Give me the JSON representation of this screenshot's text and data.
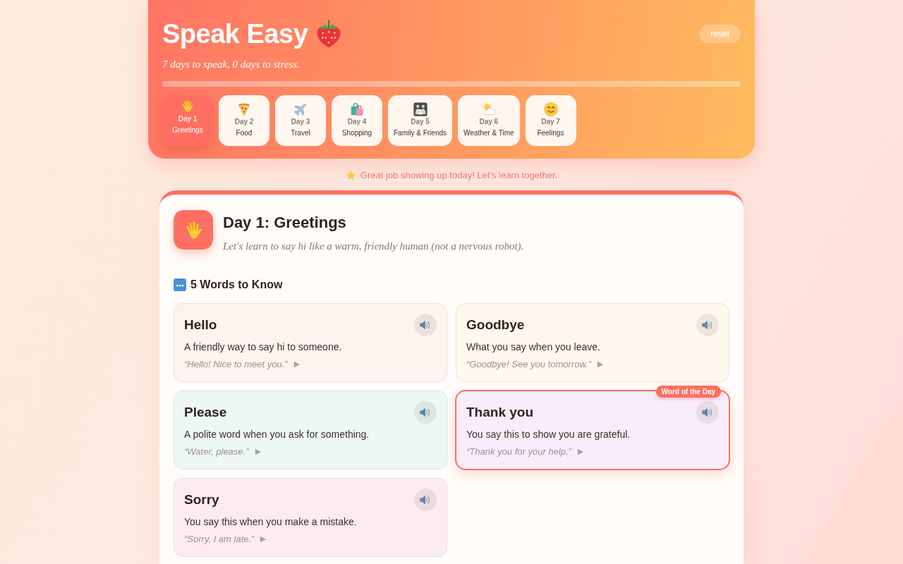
{
  "app": {
    "title": "Speak Easy",
    "tagline": "7 days to speak, 0 days to stress.",
    "reset": "reset",
    "progress": {
      "level": 0
    }
  },
  "days": [
    {
      "day": "Day 1",
      "label": "Greetings",
      "selected": true
    },
    {
      "day": "Day 2",
      "label": "Food",
      "selected": false
    },
    {
      "day": "Day 3",
      "label": "Travel",
      "selected": false
    },
    {
      "day": "Day 4",
      "label": "Shopping",
      "selected": false
    },
    {
      "day": "Day 5",
      "label": "Family & Friends",
      "selected": false
    },
    {
      "day": "Day 6",
      "label": "Weather & Time",
      "selected": false
    },
    {
      "day": "Day 7",
      "label": "Feelings",
      "selected": false
    }
  ],
  "encouragement": "Great job showing up today! Let's learn together.",
  "lesson": {
    "title": "Day 1: Greetings",
    "subtitle": "Let's learn to say hi like a warm, friendly human (not a nervous robot).",
    "section_title": "5 Words to Know",
    "words": [
      {
        "word": "Hello",
        "definition": "A friendly way to say hi to someone.",
        "example": "“Hello! Nice to meet you.”",
        "color": "#fff3ef",
        "highlighted": false
      },
      {
        "word": "Goodbye",
        "definition": "What you say when you leave.",
        "example": "“Goodbye! See you tomorrow.”",
        "color": "#fff8ee",
        "highlighted": false
      },
      {
        "word": "Please",
        "definition": "A polite word when you ask for something.",
        "example": "“Water, please.”",
        "color": "#edf8f6",
        "highlighted": false
      },
      {
        "word": "Thank you",
        "definition": "You say this to show you are grateful.",
        "example": "“Thank you for your help.”",
        "color": "#f8edfb",
        "highlighted": true
      },
      {
        "word": "Sorry",
        "definition": "You say this when you make a mistake.",
        "example": "“Sorry, I am late.”",
        "color": "#fcecf2",
        "highlighted": false
      }
    ],
    "highlight_badge": "Word of the Day"
  }
}
